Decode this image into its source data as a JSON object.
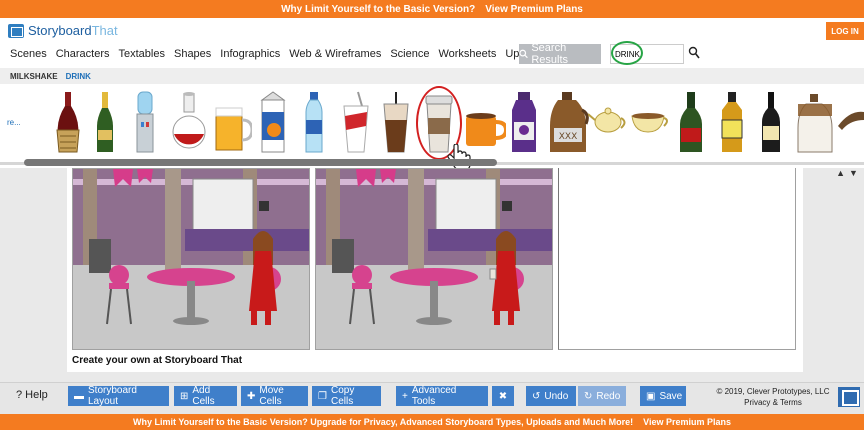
{
  "top_banner": {
    "text": "Why Limit Yourself to the Basic Version?",
    "link": "View Premium Plans"
  },
  "logo": {
    "part1": "Storyboard",
    "part2": "That"
  },
  "login": "LOG IN",
  "nav": [
    "Scenes",
    "Characters",
    "Textables",
    "Shapes",
    "Infographics",
    "Web & Wireframes",
    "Science",
    "Worksheets",
    "Upload"
  ],
  "search": {
    "button": "Search Results",
    "value": "DRINK"
  },
  "subtabs": [
    "MILKSHAKE",
    "DRINK"
  ],
  "palette": {
    "more": "re...",
    "items": [
      "wine-bottle-basket",
      "champagne-bottle",
      "water-cooler",
      "wine-carafe",
      "beer-mug",
      "juice-carton",
      "water-bottle",
      "soda-cup",
      "iced-coffee",
      "coffee-cup",
      "orange-mug",
      "grape-juice-jug",
      "xxx-jug",
      "teapot",
      "tea-cup",
      "whiskey-bottle",
      "yellow-label-bottle",
      "black-bottle",
      "moonshine-jug",
      "horn"
    ]
  },
  "caption": "Create your own at Storyboard That",
  "toolbar": {
    "help": "? Help",
    "storyboard_layout": "Storyboard Layout",
    "add_cells": "Add Cells",
    "move_cells": "Move Cells",
    "copy_cells": "Copy Cells",
    "advanced_tools": "Advanced Tools",
    "undo": "Undo",
    "redo": "Redo",
    "save": "Save",
    "copyright": "© 2019, Clever Prototypes, LLC",
    "privacy": "Privacy & Terms"
  },
  "bottom_banner": {
    "text": "Why Limit Yourself to the Basic Version? Upgrade for Privacy, Advanced Storyboard Types, Uploads and Much More!",
    "link": "View Premium Plans"
  },
  "colors": {
    "orange": "#f47b20",
    "blue": "#3f7fca",
    "green_circle": "#27a445",
    "red_circle": "#d32020"
  }
}
